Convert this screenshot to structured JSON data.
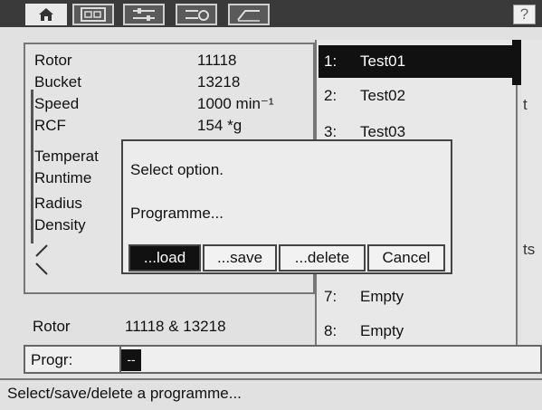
{
  "tabs": [
    {
      "name": "home",
      "icon": "home-icon",
      "active": true
    },
    {
      "name": "display",
      "icon": "display-icon",
      "active": false
    },
    {
      "name": "settings",
      "icon": "settings-icon",
      "active": false
    },
    {
      "name": "program",
      "icon": "program-icon",
      "active": false
    },
    {
      "name": "curve",
      "icon": "curve-icon",
      "active": false
    }
  ],
  "help_label": "?",
  "info": {
    "rotor": {
      "label": "Rotor",
      "value": "11118"
    },
    "bucket": {
      "label": "Bucket",
      "value": "13218"
    },
    "speed": {
      "label": "Speed",
      "value": "1000 min⁻¹"
    },
    "rcf": {
      "label": "RCF",
      "value": "154 *g"
    },
    "temperature": {
      "label": "Temperat"
    },
    "runtime": {
      "label": "Runtime"
    },
    "radius": {
      "label": "Radius"
    },
    "density": {
      "label": "Density"
    }
  },
  "program_list": [
    {
      "num": "1:",
      "name": "Test01",
      "selected": true
    },
    {
      "num": "2:",
      "name": "Test02",
      "selected": false
    },
    {
      "num": "3:",
      "name": "Test03",
      "selected": false
    },
    {
      "num": "7:",
      "name": "Empty",
      "selected": false
    },
    {
      "num": "8:",
      "name": "Empty",
      "selected": false
    }
  ],
  "side_chars": [
    "t",
    "ts"
  ],
  "dialog": {
    "prompt": "Select option.",
    "subject": "Programme...",
    "buttons": {
      "load": "...load",
      "save": "...save",
      "delete": "...delete",
      "cancel": "Cancel"
    }
  },
  "rotor_summary": {
    "label": "Rotor",
    "value": "11118 & 13218"
  },
  "progr": {
    "label": "Progr:",
    "value": "--"
  },
  "status_text": "Select/save/delete a programme..."
}
